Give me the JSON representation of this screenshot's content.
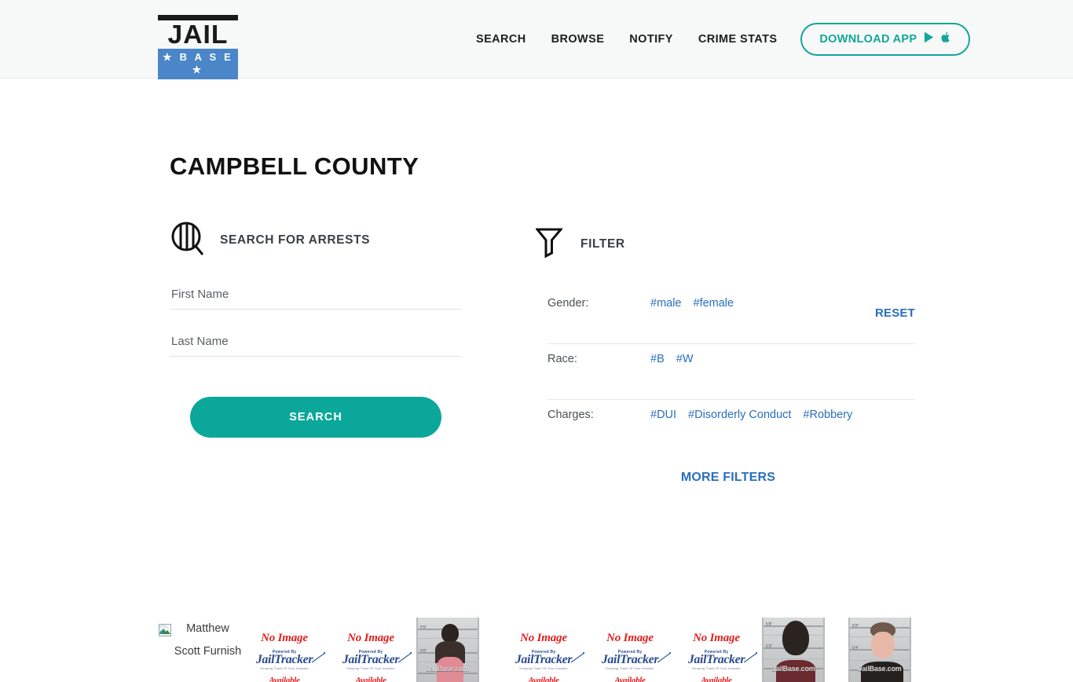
{
  "header": {
    "logo": {
      "top_word": "JAIL",
      "bottom_word": "★ B A S E ★",
      "brand_blue": "#4a86c8"
    },
    "nav": [
      {
        "label": "SEARCH"
      },
      {
        "label": "BROWSE"
      },
      {
        "label": "NOTIFY"
      },
      {
        "label": "CRIME STATS"
      }
    ],
    "download_button": {
      "label": "DOWNLOAD APP",
      "icons": [
        "google-play-icon",
        "apple-icon"
      ],
      "accent": "#11a79a"
    }
  },
  "page": {
    "title": "CAMPBELL COUNTY"
  },
  "search_panel": {
    "icon": "jail-bars-magnifier-icon",
    "heading": "SEARCH FOR ARRESTS",
    "fields": [
      {
        "name": "first-name",
        "placeholder": "First Name",
        "value": ""
      },
      {
        "name": "last-name",
        "placeholder": "Last Name",
        "value": ""
      }
    ],
    "submit_label": "SEARCH",
    "submit_color": "#0ba79a"
  },
  "filter_panel": {
    "icon": "funnel-icon",
    "heading": "FILTER",
    "reset_label": "RESET",
    "link_color": "#2a6ebb",
    "rows": [
      {
        "label": "Gender:",
        "tags": [
          "#male",
          "#female"
        ]
      },
      {
        "label": "Race:",
        "tags": [
          "#B",
          "#W"
        ]
      },
      {
        "label": "Charges:",
        "tags": [
          "#DUI",
          "#Disorderly Conduct",
          "#Robbery"
        ]
      }
    ],
    "more_filters_label": "MORE FILTERS"
  },
  "thumbnails": {
    "placeholder_text": {
      "title": "No Image",
      "powered_by": "Powered By",
      "brand": "JailTracker",
      "tagline": "Keeping Track Of Your Inmates",
      "available": "Available"
    },
    "watermark": "JailBase.com",
    "items": [
      {
        "kind": "broken-image",
        "alt": "Matthew Scott Furnish"
      },
      {
        "kind": "no-image"
      },
      {
        "kind": "no-image"
      },
      {
        "kind": "mugshot",
        "subject": "female-dark-hair-pink-top"
      },
      {
        "kind": "no-image"
      },
      {
        "kind": "no-image"
      },
      {
        "kind": "no-image"
      },
      {
        "kind": "mugshot",
        "subject": "female-dark-hair"
      },
      {
        "kind": "mugshot",
        "subject": "male-light-hair"
      }
    ]
  }
}
